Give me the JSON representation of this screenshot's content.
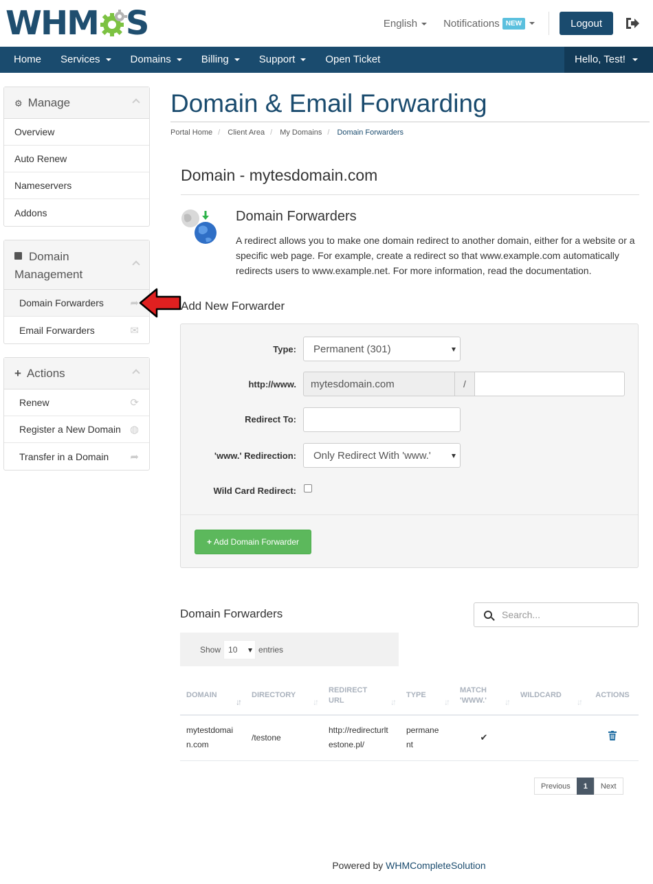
{
  "header": {
    "logo_text_left": "WHM",
    "logo_text_right": "S",
    "language_label": "English",
    "notifications_label": "Notifications",
    "notifications_badge": "NEW",
    "logout_label": "Logout"
  },
  "nav": {
    "items": [
      {
        "label": "Home",
        "dropdown": false
      },
      {
        "label": "Services",
        "dropdown": true
      },
      {
        "label": "Domains",
        "dropdown": true
      },
      {
        "label": "Billing",
        "dropdown": true
      },
      {
        "label": "Support",
        "dropdown": true
      },
      {
        "label": "Open Ticket",
        "dropdown": false
      }
    ],
    "user_label": "Hello, Test!"
  },
  "sidebar": {
    "manage": {
      "title": "Manage",
      "icon": "gear-icon",
      "items": [
        "Overview",
        "Auto Renew",
        "Nameservers",
        "Addons"
      ]
    },
    "domain_management": {
      "title_line1": "Domain",
      "title_line2": "Management",
      "icon": "calendar-icon",
      "items": [
        {
          "label": "Domain Forwarders",
          "icon": "share-icon",
          "active": true
        },
        {
          "label": "Email Forwarders",
          "icon": "envelope-icon",
          "active": false
        }
      ]
    },
    "actions": {
      "title": "Actions",
      "icon": "plus-icon",
      "items": [
        {
          "label": "Renew",
          "icon": "refresh-icon"
        },
        {
          "label": "Register a New Domain",
          "icon": "globe-icon"
        },
        {
          "label": "Transfer in a Domain",
          "icon": "share-icon"
        }
      ]
    }
  },
  "page": {
    "title": "Domain & Email Forwarding",
    "breadcrumb": [
      "Portal Home",
      "Client Area",
      "My Domains",
      "Domain Forwarders"
    ],
    "domain_heading": "Domain - mytesdomain.com",
    "forwarders_title": "Domain Forwarders",
    "forwarders_desc": "A redirect allows you to make one domain redirect to another domain, either for a website or a specific web page. For example, create a redirect so that www.example.com automatically redirects users to www.example.net. For more information, read the documentation."
  },
  "form": {
    "heading": "Add New Forwarder",
    "type_label": "Type:",
    "type_value": "Permanent (301)",
    "http_label": "http://www.",
    "http_domain": "mytesdomain.com",
    "http_slash": "/",
    "redirect_label": "Redirect To:",
    "www_label": "'www.' Redirection:",
    "www_value": "Only Redirect With 'www.'",
    "wildcard_label": "Wild Card Redirect:",
    "wildcard_checked": false,
    "add_button": "Add Domain Forwarder"
  },
  "list": {
    "heading": "Domain Forwarders",
    "search_placeholder": "Search...",
    "show_label": "Show",
    "show_value": "10",
    "entries_label": "entries",
    "columns": [
      "DOMAIN",
      "DIRECTORY",
      "REDIRECT URL",
      "TYPE",
      "MATCH 'WWW.'",
      "WILDCARD",
      "ACTIONS"
    ],
    "rows": [
      {
        "domain": "mytestdomain.com",
        "directory": "/testone",
        "redirect_url": "http://redirecturltestone.pl/",
        "type": "permanent",
        "match_www": true,
        "wildcard": false
      }
    ],
    "pagination": {
      "previous": "Previous",
      "page": "1",
      "next": "Next"
    }
  },
  "footer": {
    "prefix": "Powered by ",
    "link": "WHMCompleteSolution"
  },
  "colors": {
    "brand": "#1a4b6e",
    "accent_green": "#5cb85c",
    "badge_blue": "#5bc0de",
    "annotation_red": "#e02020"
  }
}
